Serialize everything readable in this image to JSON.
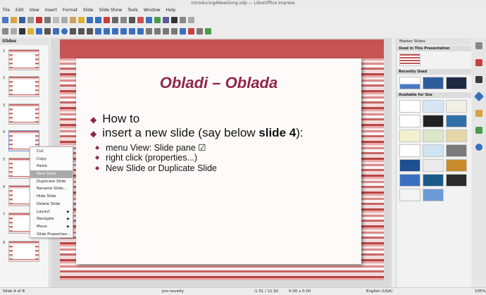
{
  "window_title": "IntroducingANewSong.odp — LibreOffice Impress",
  "menu": [
    "File",
    "Edit",
    "View",
    "Insert",
    "Format",
    "Slide",
    "Slide Show",
    "Tools",
    "Window",
    "Help"
  ],
  "slides_pane": {
    "title": "Slides",
    "numbers": [
      "1",
      "2",
      "3",
      "4",
      "5",
      "6",
      "7",
      "8"
    ]
  },
  "context_menu": [
    {
      "label": "Cut",
      "submenu": false
    },
    {
      "label": "Copy",
      "submenu": false
    },
    {
      "label": "Paste",
      "submenu": false
    },
    {
      "label": "New Slide",
      "submenu": false,
      "highlighted": true
    },
    {
      "label": "Duplicate Slide",
      "submenu": false
    },
    {
      "label": "Rename Slide...",
      "submenu": false
    },
    {
      "label": "Hide Slide",
      "submenu": false
    },
    {
      "label": "Delete Slide",
      "submenu": false
    },
    {
      "label": "Layout",
      "submenu": true
    },
    {
      "label": "Navigate",
      "submenu": true
    },
    {
      "label": "Move",
      "submenu": true
    },
    {
      "label": "Slide Properties...",
      "submenu": false
    }
  ],
  "slide": {
    "title": "Obladi – Oblada",
    "bullets": [
      "How to",
      "insert a new slide (say below "
    ],
    "bullet_bold": "slide 4",
    "bullet_end": "):",
    "sub_bullets": [
      "menu View: Slide pane ☑",
      "right  click  (properties...)",
      "New  Slide  or  Duplicate  Slide"
    ]
  },
  "master_pane": {
    "title": "Master Slides",
    "sections": [
      "Used in This Presentation",
      "Recently Used",
      "Available for Use"
    ]
  },
  "status": {
    "slide": "Slide 4 of 8",
    "master": "prs-novelty",
    "coords": "-1.31 / 11.92",
    "size": "0.00 x 0.00",
    "lang": "English (USA)",
    "zoom": "105%"
  },
  "colors": {
    "accent": "#8e2848",
    "stripe": "#c65454"
  }
}
